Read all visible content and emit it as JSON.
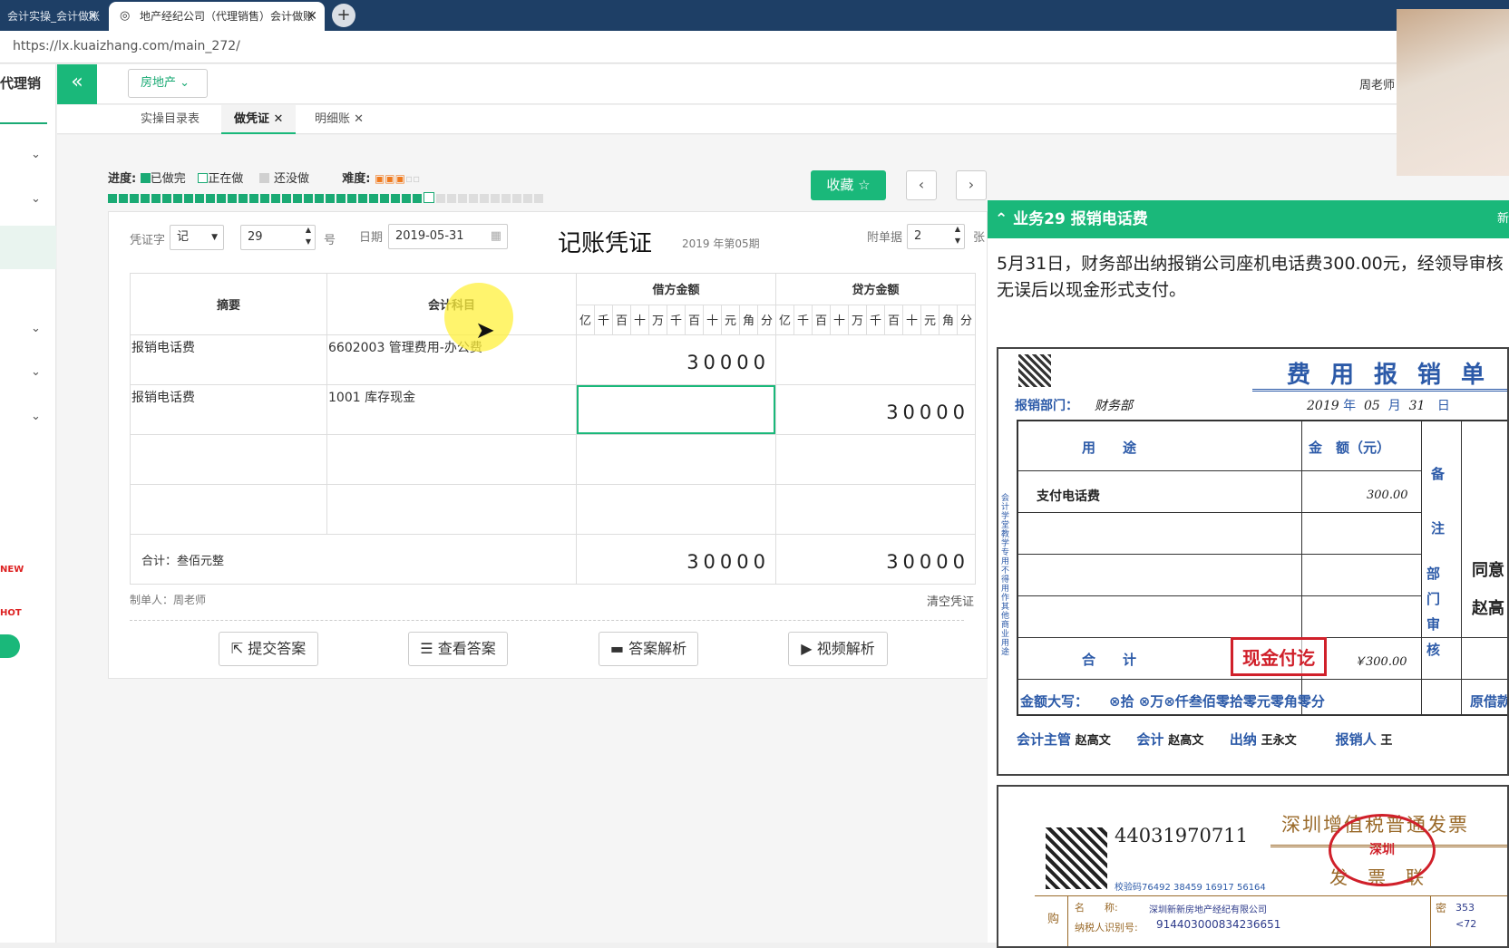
{
  "browser": {
    "tabs": [
      {
        "label": "会计实操_会计做账",
        "active": false
      },
      {
        "label": "地产经纪公司（代理销售）会计做账",
        "active": true
      }
    ],
    "url": "https://lx.kuaizhang.com/main_272/"
  },
  "sidebar": {
    "brand": "代理销",
    "hot_a": "NEW",
    "hot_b": "HOT"
  },
  "header": {
    "industry": "房地产",
    "user": "周老师"
  },
  "page_tabs": [
    {
      "label": "实操目录表"
    },
    {
      "label": "做凭证"
    },
    {
      "label": "明细账"
    }
  ],
  "progress": {
    "label": "进度:",
    "done": "已做完",
    "doing": "正在做",
    "todo": "还没做",
    "difficulty_label": "难度:",
    "difficulty": "3 of 5",
    "done_count": 29,
    "total": 40
  },
  "actions": {
    "favorite": "收藏 ☆",
    "prev": "‹",
    "next": "›"
  },
  "voucher": {
    "word_label": "凭证字",
    "word": "记",
    "number": "29",
    "number_suffix": "号",
    "date_label": "日期",
    "date": "2019-05-31",
    "title": "记账凭证",
    "period": "2019 年第05期",
    "attach_label": "附单据",
    "attach": "2",
    "attach_suffix": "张",
    "col_summary": "摘要",
    "col_subject": "会计科目",
    "col_debit": "借方金额",
    "col_credit": "贷方金额",
    "digit_units": [
      "亿",
      "千",
      "百",
      "十",
      "万",
      "千",
      "百",
      "十",
      "元",
      "角",
      "分"
    ],
    "rows": [
      {
        "summary": "报销电话费",
        "subject": "6602003 管理费用-办公费",
        "debit": "30000",
        "credit": ""
      },
      {
        "summary": "报销电话费",
        "subject": "1001 库存现金",
        "debit": "",
        "credit": "30000"
      },
      {
        "summary": "",
        "subject": "",
        "debit": "",
        "credit": ""
      },
      {
        "summary": "",
        "subject": "",
        "debit": "",
        "credit": ""
      }
    ],
    "total_label": "合计：叁佰元整",
    "total_debit": "30000",
    "total_credit": "30000",
    "maker": "制单人：周老师",
    "clear": "清空凭证",
    "buttons": {
      "submit": "提交答案",
      "view": "查看答案",
      "explain": "答案解析",
      "video": "视频解析"
    }
  },
  "task": {
    "title": "业务29 报销电话费",
    "new_label": "新",
    "description": "5月31日，财务部出纳报销公司座机电话费300.00元，经领导审核无误后以现金形式支付。"
  },
  "expense_form": {
    "title": "费用报销单",
    "dept_label": "报销部门：",
    "dept": "财务部",
    "date_year": "2019",
    "date_month": "05",
    "date_day": "31",
    "y": "年",
    "m": "月",
    "d": "日",
    "col_use": "用　　途",
    "col_amount": "金　额（元）",
    "col_note": "备　注",
    "item": "支付电话费",
    "item_amount": "300.00",
    "total_label": "合　　计",
    "total_amount": "￥300.00",
    "stamp": "现金付讫",
    "approve_label": "部门审核",
    "approve_a": "同意",
    "approve_b": "赵高",
    "side_note": "会计学堂教学专用 不得用作其他商业用途",
    "capital_label": "金额大写：",
    "capital": "⊗拾 ⊗万⊗仟叁佰零拾零元零角零分",
    "loan_label": "原借款:",
    "supervisor_label": "会计主管",
    "supervisor": "赵高文",
    "accountant_label": "会计",
    "accountant": "赵高文",
    "cashier_label": "出纳",
    "cashier": "王永文",
    "claimant_label": "报销人",
    "claimant": "王"
  },
  "invoice": {
    "code": "44031970711",
    "title": "深圳增值税普通发票",
    "copy": "发票联",
    "check_code": "校验码76492 38459 16917 56164",
    "buyer_name_label": "名　　称:",
    "buyer_name": "深圳新新房地产经纪有限公司",
    "tax_id_label": "纳税人识别号:",
    "tax_id": "914403000834236651",
    "buyer_label": "购",
    "secret_label": "密",
    "secret": "353",
    "secret2": "<72",
    "seal": "深圳"
  }
}
